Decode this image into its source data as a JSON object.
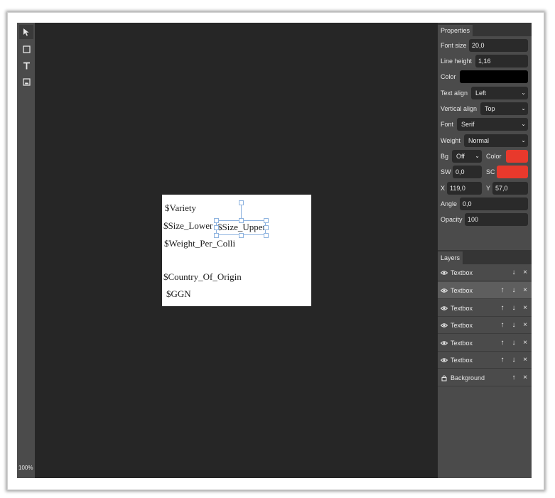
{
  "toolbar": {
    "tools": [
      {
        "name": "select-tool",
        "icon": "cursor-arrow-icon"
      },
      {
        "name": "rectangle-tool",
        "icon": "square-icon"
      },
      {
        "name": "text-tool",
        "icon": "text-t-icon"
      },
      {
        "name": "image-tool",
        "icon": "image-icon"
      }
    ],
    "zoom": "100%"
  },
  "canvas": {
    "texts": [
      "$Variety",
      "$Size_Lower",
      "$Size_Upper",
      "$Weight_Per_Colli",
      "$Country_Of_Origin",
      "$GGN"
    ]
  },
  "properties": {
    "tab": "Properties",
    "font_size_label": "Font size",
    "font_size": "20,0",
    "line_height_label": "Line height",
    "line_height": "1,16",
    "color_label": "Color",
    "color_value": "#000000",
    "text_align_label": "Text align",
    "text_align": "Left",
    "vertical_align_label": "Vertical align",
    "vertical_align": "Top",
    "font_label": "Font",
    "font": "Serif",
    "weight_label": "Weight",
    "weight": "Normal",
    "bg_label": "Bg",
    "bg": "Off",
    "bg_color_label": "Color",
    "bg_color_value": "#e8392c",
    "sw_label": "SW",
    "sw": "0,0",
    "sc_label": "SC",
    "sc_color_value": "#e8392c",
    "x_label": "X",
    "x": "119,0",
    "y_label": "Y",
    "y": "57,0",
    "angle_label": "Angle",
    "angle": "0,0",
    "opacity_label": "Opacity",
    "opacity": "100"
  },
  "layers": {
    "tab": "Layers",
    "items": [
      {
        "name": "Textbox",
        "icon": "eye-icon"
      },
      {
        "name": "Textbox",
        "icon": "eye-icon"
      },
      {
        "name": "Textbox",
        "icon": "eye-icon"
      },
      {
        "name": "Textbox",
        "icon": "eye-icon"
      },
      {
        "name": "Textbox",
        "icon": "eye-icon"
      },
      {
        "name": "Textbox",
        "icon": "eye-icon"
      },
      {
        "name": "Background",
        "icon": "lock-icon"
      }
    ],
    "up_glyph": "↑",
    "down_glyph": "↓",
    "delete_glyph": "×"
  }
}
